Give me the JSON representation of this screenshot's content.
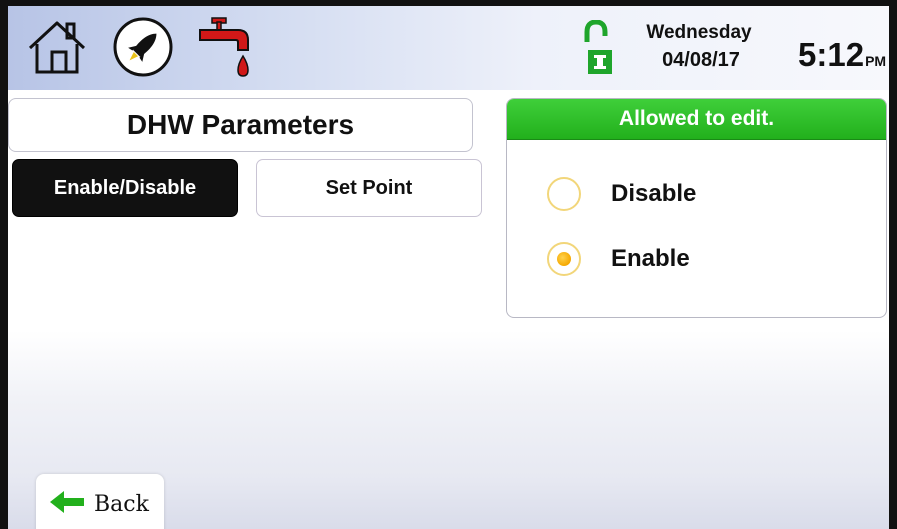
{
  "topbar": {
    "day": "Wednesday",
    "date": "04/08/17",
    "time": "5:12",
    "ampm": "PM",
    "icons": [
      "home-icon",
      "rocket-icon",
      "water-tap-icon",
      "unlocked-lock-icon"
    ]
  },
  "page": {
    "title": "DHW Parameters"
  },
  "tabs": [
    {
      "label": "Enable/Disable",
      "active": true
    },
    {
      "label": "Set Point",
      "active": false
    }
  ],
  "status_panel": {
    "header": "Allowed to edit.",
    "options": [
      {
        "label": "Disable",
        "selected": false
      },
      {
        "label": "Enable",
        "selected": true
      }
    ]
  },
  "back": {
    "label": "Back"
  },
  "colors": {
    "accent_green": "#22b01c",
    "tap_red": "#d01818",
    "lock_green": "#1fa52b",
    "radio_selected": "#f5a800"
  }
}
